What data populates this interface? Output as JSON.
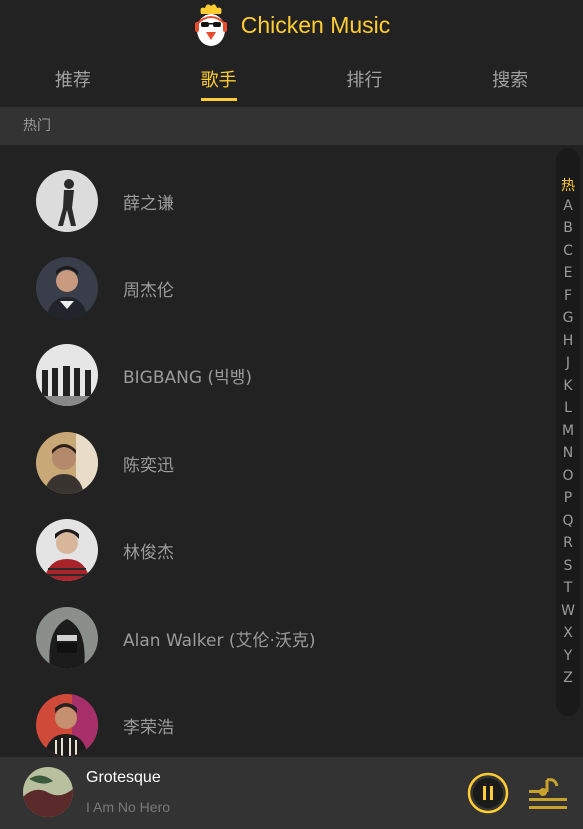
{
  "header": {
    "title": "Chicken Music",
    "logo_icon": "chicken-logo-icon"
  },
  "tabs": [
    {
      "label": "推荐",
      "active": false
    },
    {
      "label": "歌手",
      "active": true
    },
    {
      "label": "排行",
      "active": false
    },
    {
      "label": "搜索",
      "active": false
    }
  ],
  "group": {
    "title": "热门"
  },
  "singers": [
    {
      "name": "薛之谦"
    },
    {
      "name": "周杰伦"
    },
    {
      "name": "BIGBANG (빅뱅)"
    },
    {
      "name": "陈奕迅"
    },
    {
      "name": "林俊杰"
    },
    {
      "name": "Alan Walker (艾伦·沃克)"
    },
    {
      "name": "李荣浩"
    }
  ],
  "shortcut": [
    "热",
    "A",
    "B",
    "C",
    "E",
    "F",
    "G",
    "H",
    "J",
    "K",
    "L",
    "M",
    "N",
    "O",
    "P",
    "Q",
    "R",
    "S",
    "T",
    "W",
    "X",
    "Y",
    "Z"
  ],
  "player": {
    "song": "Grotesque",
    "artist": "I Am No Hero",
    "state_icon": "pause-icon",
    "playlist_icon": "playlist-icon"
  },
  "colors": {
    "accent": "#ffcd32",
    "background": "#222222",
    "panel": "#333333"
  }
}
